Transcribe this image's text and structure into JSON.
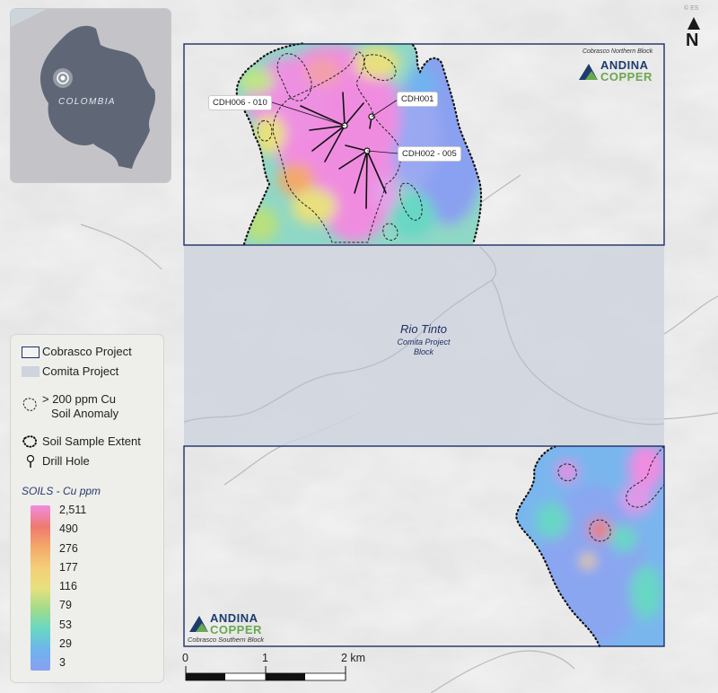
{
  "inset": {
    "country_label": "COLOMBIA"
  },
  "north_arrow": {
    "label": "N"
  },
  "credit": "© ES",
  "northern_block": {
    "caption": "Cobrasco Northern Block",
    "logo_line1": "ANDINA",
    "logo_line2": "COPPER"
  },
  "southern_block": {
    "caption": "Cobrasco Southern Block",
    "logo_line1": "ANDINA",
    "logo_line2": "COPPER"
  },
  "comita": {
    "title": "Rio Tinto",
    "subtitle_line1": "Comita Project",
    "subtitle_line2": "Block"
  },
  "drill_labels": {
    "cdh006": "CDH006 - 010",
    "cdh001": "CDH001",
    "cdh002": "CDH002 - 005"
  },
  "legend": {
    "cobrasco": "Cobrasco Project",
    "comita": "Comita Project",
    "anomaly_line1": "> 200 ppm Cu",
    "anomaly_line2": "Soil Anomaly",
    "extent": "Soil Sample Extent",
    "drill": "Drill Hole",
    "soils_title": "SOILS - Cu ppm",
    "ticks": [
      "2,511",
      "490",
      "276",
      "177",
      "116",
      "79",
      "53",
      "29",
      "3"
    ],
    "ramp_colors": [
      "#f08ce0",
      "#ef7a6e",
      "#f3a86a",
      "#f4cf78",
      "#e8e07e",
      "#9fdc8a",
      "#67d7c4",
      "#6fb3ef",
      "#8aa0f0"
    ]
  },
  "scale": {
    "labels": [
      "0",
      "1",
      "2 km"
    ]
  },
  "colors": {
    "frame": "#1f2f63",
    "comita_fill": "#cfd3de",
    "accent_navy": "#1d3c6e",
    "accent_green": "#6aa84f"
  }
}
